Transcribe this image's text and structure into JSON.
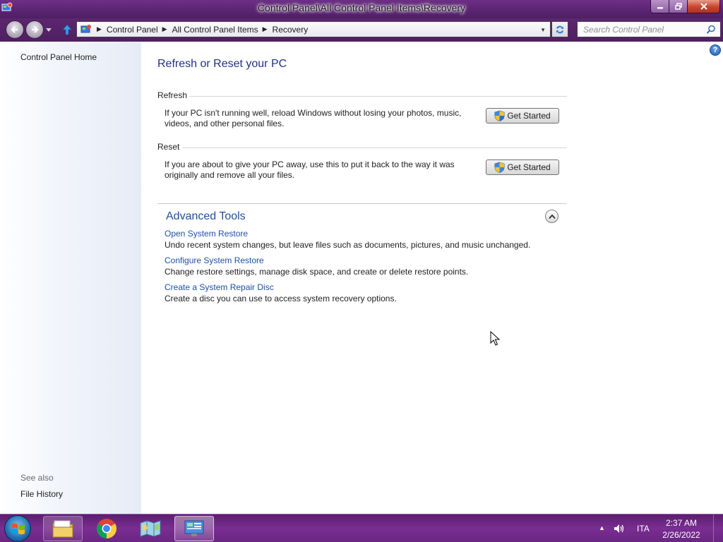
{
  "window": {
    "title": "Control Panel\\All Control Panel Items\\Recovery"
  },
  "address": {
    "crumbs": [
      "Control Panel",
      "All Control Panel Items",
      "Recovery"
    ],
    "search_placeholder": "Search Control Panel"
  },
  "sidebar": {
    "home_link": "Control Panel Home",
    "see_also_label": "See also",
    "file_history_link": "File History"
  },
  "main": {
    "title": "Refresh or Reset your PC",
    "refresh": {
      "heading": "Refresh",
      "text_line1": "If your PC isn't running well, reload Windows without losing your photos, music,",
      "text_line2": "videos, and other personal files.",
      "button": "Get Started"
    },
    "reset": {
      "heading": "Reset",
      "text_line1": "If you are about to give your PC away, use this to put it back to the way it was",
      "text_line2": "originally and remove all your files.",
      "button": "Get Started"
    },
    "advanced": {
      "title": "Advanced Tools",
      "tools": [
        {
          "link": "Open System Restore",
          "desc": "Undo recent system changes, but leave files such as documents, pictures, and music unchanged."
        },
        {
          "link": "Configure System Restore",
          "desc": "Change restore settings, manage disk space, and create or delete restore points."
        },
        {
          "link": "Create a System Repair Disc",
          "desc": "Create a disc you can use to access system recovery options."
        }
      ]
    }
  },
  "taskbar": {
    "language": "ITA",
    "time": "2:37 AM",
    "date": "2/26/2022"
  },
  "colors": {
    "title_bar": "#5a2471",
    "taskbar": "#7a2d92",
    "link": "#1e4fa8",
    "heading": "#1e3287"
  }
}
